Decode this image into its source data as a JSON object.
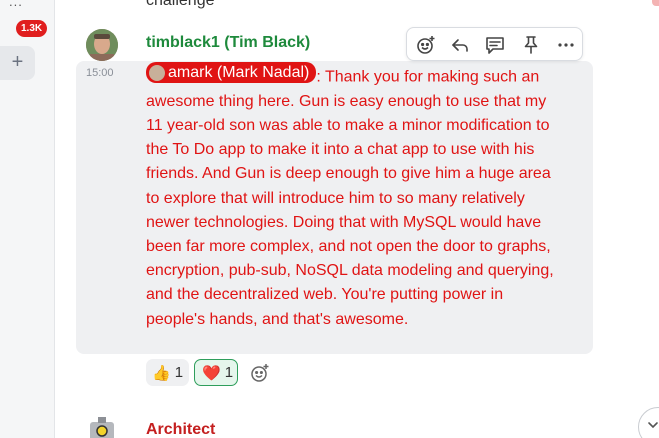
{
  "rail": {
    "more_label": "...",
    "unread_badge": "1.3K",
    "add_icon": "plus-icon"
  },
  "previous_message": {
    "text_tail": "challenge"
  },
  "message": {
    "sender": "timblack1 (Tim Black)",
    "time": "15:00",
    "mention": "amark (Mark Nadal)",
    "text": ": Thank you for making such an awesome thing here. Gun is easy enough to use that my 11 year-old son was able to make a minor modification to the To Do app to make it into a chat app to use with his friends. And Gun is deep enough to give him a huge area to explore that will introduce him to so many relatively newer technologies. Doing that with MySQL would have been far more complex, and not open the door to graphs, encryption, pub-sub, NoSQL data modeling and querying, and the decentralized web. You're putting power in people's hands, and that's awesome.",
    "reactions": [
      {
        "emoji": "👍",
        "count": "1",
        "icon": "thumbs-up-icon"
      },
      {
        "emoji": "❤️",
        "count": "1",
        "icon": "heart-icon"
      }
    ],
    "toolbar_icons": [
      "add-reaction-icon",
      "reply-icon",
      "thread-icon",
      "pin-icon",
      "more-icon"
    ]
  },
  "next_message": {
    "sender": "Architect"
  },
  "colors": {
    "sender_green": "#1e8a3c",
    "message_red": "#e01414",
    "badge_red": "#e01e1e",
    "architect_red": "#c41f1f"
  }
}
